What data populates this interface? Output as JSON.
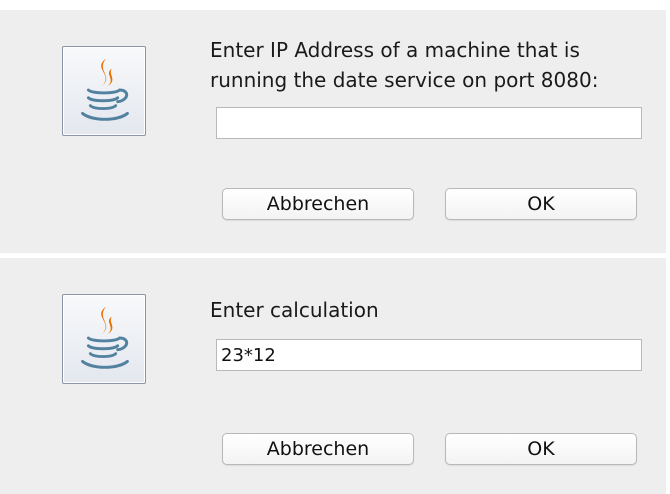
{
  "dialogs": [
    {
      "icon": "java-coffee-cup-icon",
      "prompt_line1": "Enter IP Address of a machine that is",
      "prompt_line2": "running the date service on port 8080:",
      "input_value": "",
      "cancel_label": "Abbrechen",
      "ok_label": "OK"
    },
    {
      "icon": "java-coffee-cup-icon",
      "prompt_line1": "Enter calculation",
      "input_value": "23*12",
      "cancel_label": "Abbrechen",
      "ok_label": "OK"
    }
  ],
  "colors": {
    "dialog_background": "#eeeeee",
    "java_blue": "#5382a1",
    "java_orange": "#e76f00"
  }
}
